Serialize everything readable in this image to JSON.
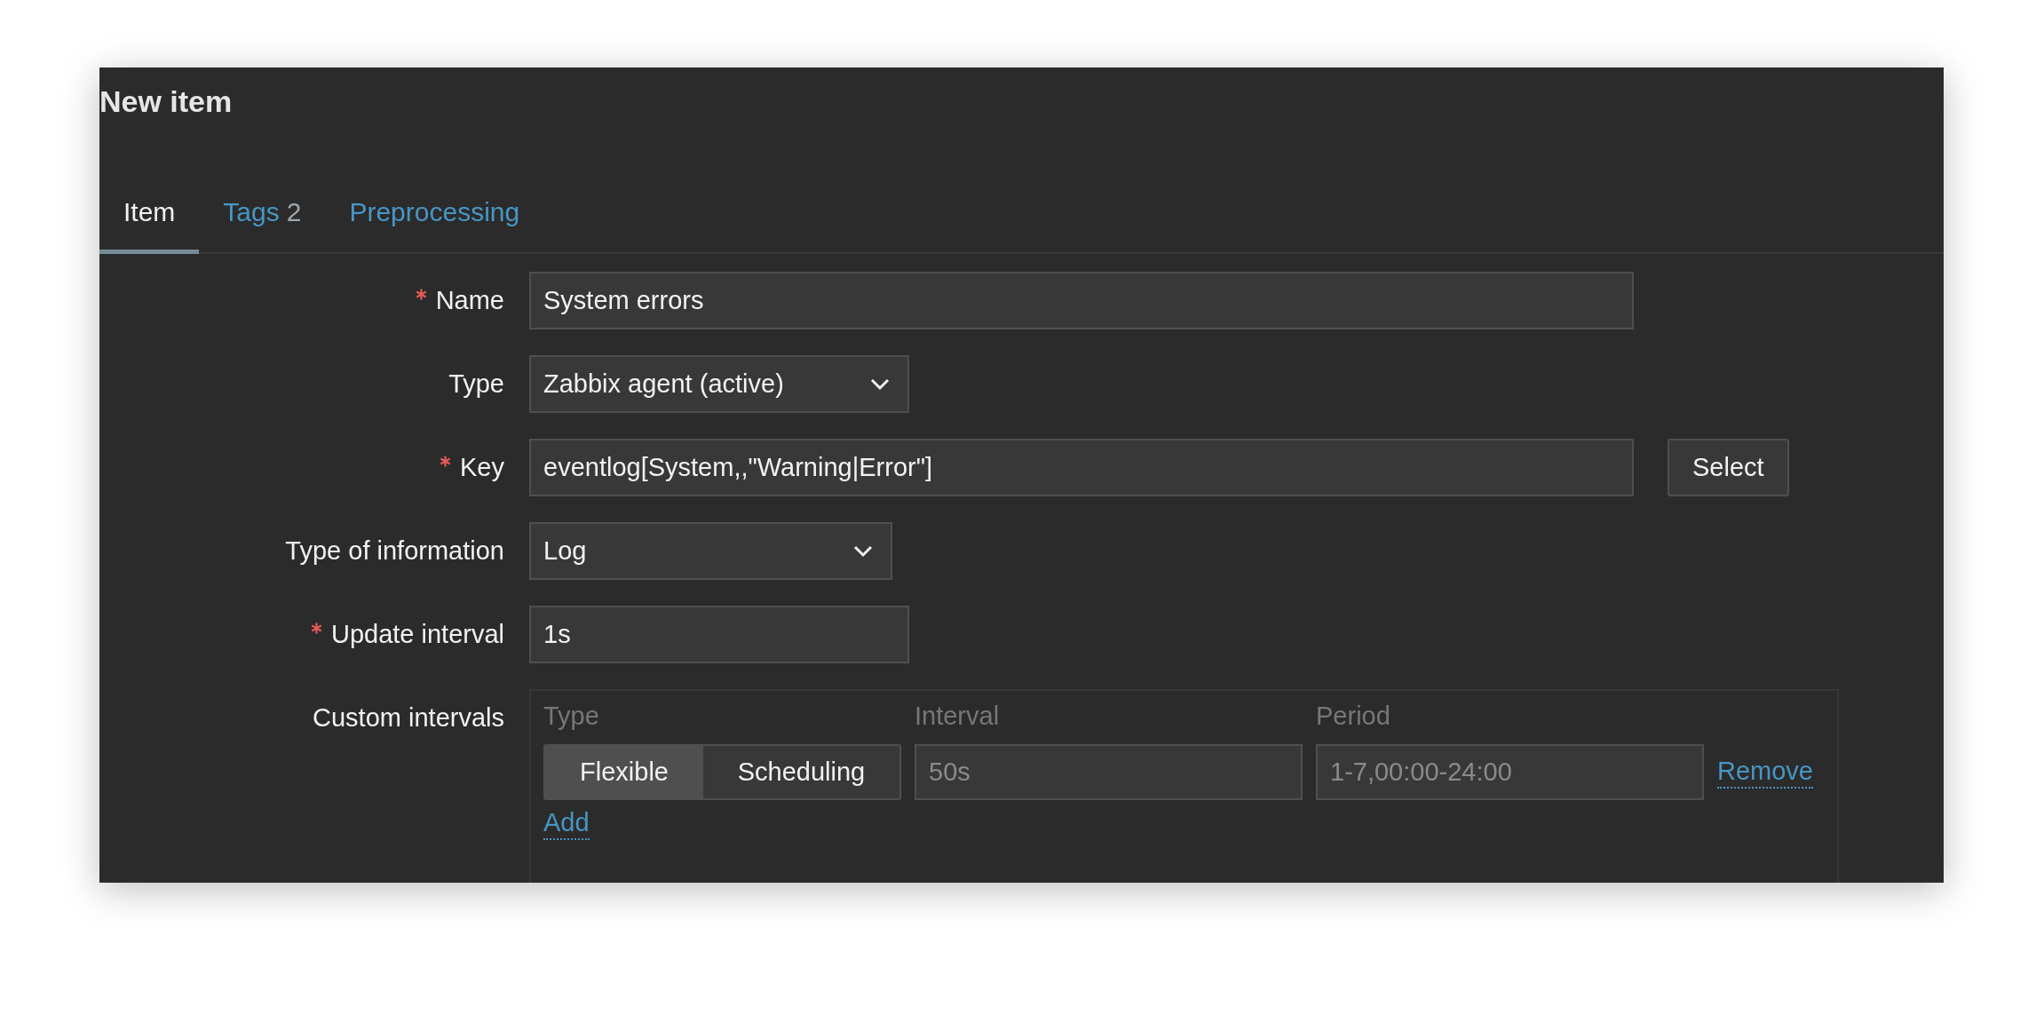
{
  "title": "New item",
  "tabs": [
    {
      "label": "Item",
      "selected": true
    },
    {
      "label": "Tags",
      "count": "2",
      "selected": false
    },
    {
      "label": "Preprocessing",
      "selected": false
    }
  ],
  "fields": [
    {
      "kind": "text",
      "label": "Name",
      "required": true,
      "value": "System errors"
    },
    {
      "kind": "select",
      "label": "Type",
      "required": false,
      "value": "Zabbix agent (active)"
    },
    {
      "kind": "text_button",
      "label": "Key",
      "required": true,
      "value": "eventlog[System,,\"Warning|Error\"]",
      "button": "Select"
    },
    {
      "kind": "select",
      "label": "Type of information",
      "required": false,
      "value": "Log"
    },
    {
      "kind": "text",
      "label": "Update interval",
      "required": true,
      "value": "1s"
    },
    {
      "kind": "intervals",
      "label": "Custom intervals",
      "required": false,
      "columns": [
        "Type",
        "Interval",
        "Period"
      ],
      "rows": [
        {
          "modes": [
            {
              "label": "Flexible",
              "selected": true
            },
            {
              "label": "Scheduling",
              "selected": false
            }
          ],
          "interval_placeholder": "50s",
          "period_placeholder": "1-7,00:00-24:00",
          "remove": "Remove"
        }
      ],
      "add": "Add"
    }
  ]
}
